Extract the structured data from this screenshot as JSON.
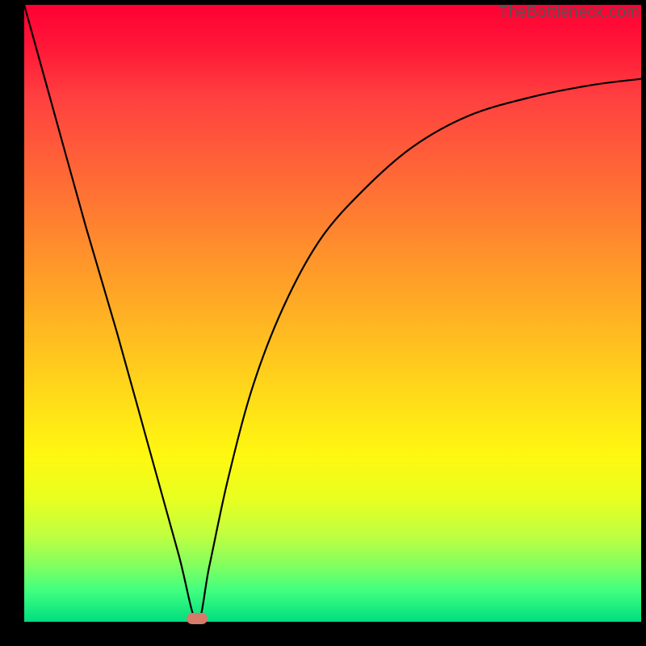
{
  "watermark": "TheBottleneck.com",
  "chart_data": {
    "type": "line",
    "title": "",
    "xlabel": "",
    "ylabel": "",
    "xlim": [
      0,
      1
    ],
    "ylim": [
      0,
      1
    ],
    "grid": false,
    "legend": false,
    "series": [
      {
        "name": "curve",
        "x": [
          0.0,
          0.05,
          0.1,
          0.15,
          0.2,
          0.25,
          0.28,
          0.3,
          0.33,
          0.37,
          0.42,
          0.48,
          0.55,
          0.63,
          0.72,
          0.82,
          0.92,
          1.0
        ],
        "values": [
          1.0,
          0.82,
          0.64,
          0.47,
          0.29,
          0.11,
          0.0,
          0.09,
          0.23,
          0.38,
          0.51,
          0.62,
          0.7,
          0.77,
          0.82,
          0.85,
          0.87,
          0.88
        ]
      }
    ],
    "marker": {
      "x": 0.28,
      "y": 0.0
    },
    "background_gradient": {
      "top": "#ff0033",
      "mid": "#ffd020",
      "bottom": "#00dd80"
    }
  }
}
